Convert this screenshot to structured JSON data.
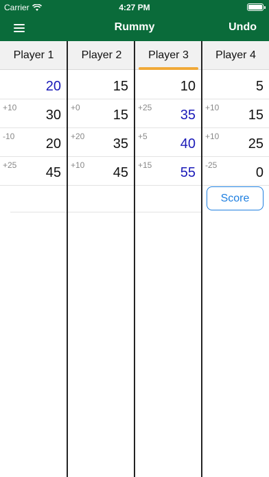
{
  "status": {
    "carrier": "Carrier",
    "time": "4:27 PM"
  },
  "nav": {
    "title": "Rummy",
    "undo_label": "Undo"
  },
  "players": [
    {
      "name": "Player 1"
    },
    {
      "name": "Player 2"
    },
    {
      "name": "Player 3"
    },
    {
      "name": "Player 4"
    }
  ],
  "rows": [
    {
      "cells": [
        {
          "delta": "",
          "total": "20"
        },
        {
          "delta": "",
          "total": "15"
        },
        {
          "delta": "",
          "total": "10"
        },
        {
          "delta": "",
          "total": "5"
        }
      ]
    },
    {
      "cells": [
        {
          "delta": "+10",
          "total": "30"
        },
        {
          "delta": "+0",
          "total": "15"
        },
        {
          "delta": "+25",
          "total": "35"
        },
        {
          "delta": "+10",
          "total": "15"
        }
      ]
    },
    {
      "cells": [
        {
          "delta": "-10",
          "total": "20"
        },
        {
          "delta": "+20",
          "total": "35"
        },
        {
          "delta": "+5",
          "total": "40"
        },
        {
          "delta": "+10",
          "total": "25"
        }
      ]
    },
    {
      "cells": [
        {
          "delta": "+25",
          "total": "45"
        },
        {
          "delta": "+10",
          "total": "45"
        },
        {
          "delta": "+15",
          "total": "55"
        },
        {
          "delta": "-25",
          "total": "0"
        }
      ]
    }
  ],
  "score_button_label": "Score",
  "colors": {
    "header_green": "#0a6b3a",
    "selected_indicator": "#f0a938",
    "leader_blue": "#1a1ab8",
    "button_blue": "#1e7fe0"
  },
  "selected_player": "Player 3"
}
